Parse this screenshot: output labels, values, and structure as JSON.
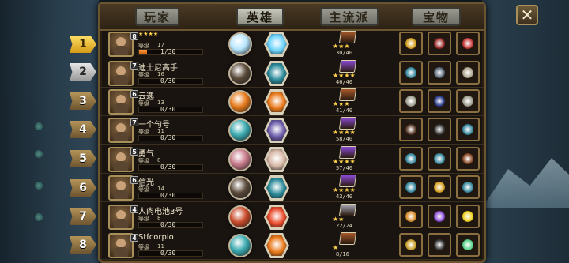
{
  "tabs": [
    {
      "label": "玩家",
      "active": false
    },
    {
      "label": "英雄",
      "active": true
    },
    {
      "label": "主流派",
      "active": false
    },
    {
      "label": "宝物",
      "active": false
    }
  ],
  "close_label": "✕",
  "rows": [
    {
      "rank": "1",
      "vip": "8",
      "name": "",
      "stars": "★★★★",
      "level_label": "等级",
      "level": "17",
      "xp": "1/30",
      "xp_fraction": 0.12,
      "book_stars": "★★★",
      "book_count": "30/40",
      "book_color": "#a85a2a",
      "hero_color": "#b8e6ff",
      "hex_color": "#6ad4ff",
      "treasures": [
        "#d4a020",
        "#9a2a2a",
        "#c83a3a"
      ]
    },
    {
      "rank": "2",
      "vip": "7",
      "name": "迪士尼高手",
      "stars": "",
      "level_label": "等级",
      "level": "16",
      "xp": "0/30",
      "xp_fraction": 0,
      "book_stars": "★★★★",
      "book_count": "46/40",
      "book_color": "#8a4ad4",
      "hero_color": "#5a4a3a",
      "hex_color": "#2a8a9a",
      "treasures": [
        "#3a8aa0",
        "#5a6a7a",
        "#b0a890"
      ]
    },
    {
      "rank": "3",
      "vip": "6",
      "name": "云逸",
      "stars": "",
      "level_label": "等级",
      "level": "13",
      "xp": "0/30",
      "xp_fraction": 0,
      "book_stars": "★★★",
      "book_count": "41/40",
      "book_color": "#a85a2a",
      "hero_color": "#e87a1a",
      "hex_color": "#e8781a",
      "treasures": [
        "#a0a090",
        "#2a3a8a",
        "#a0a090"
      ]
    },
    {
      "rank": "4",
      "vip": "7",
      "name": "一个句号",
      "stars": "",
      "level_label": "等级",
      "level": "11",
      "xp": "0/30",
      "xp_fraction": 0,
      "book_stars": "★★★★",
      "book_count": "58/40",
      "book_color": "#8a4ad4",
      "hero_color": "#3aaab0",
      "hex_color": "#6a5aa8",
      "treasures": [
        "#5a3a2a",
        "#3a3a3a",
        "#3a8aa0"
      ]
    },
    {
      "rank": "5",
      "vip": "5",
      "name": "勇气",
      "stars": "",
      "level_label": "等级",
      "level": "8",
      "xp": "0/30",
      "xp_fraction": 0,
      "book_stars": "★★★★",
      "book_count": "57/40",
      "book_color": "#8a4ad4",
      "hero_color": "#c87a8a",
      "hex_color": "#d8b8a8",
      "treasures": [
        "#3a8aa0",
        "#3a8aa0",
        "#8a4a2a"
      ]
    },
    {
      "rank": "6",
      "vip": "6",
      "name": "信光",
      "stars": "",
      "level_label": "等级",
      "level": "14",
      "xp": "0/30",
      "xp_fraction": 0,
      "book_stars": "★★★★",
      "book_count": "43/40",
      "book_color": "#8a4ad4",
      "hero_color": "#5a4a3a",
      "hex_color": "#2a8a9a",
      "treasures": [
        "#3a8aa0",
        "#d4a020",
        "#3a8aa0"
      ]
    },
    {
      "rank": "7",
      "vip": "4",
      "name": "人肉电池3号",
      "stars": "",
      "level_label": "等级",
      "level": "8",
      "xp": "0/30",
      "xp_fraction": 0,
      "book_stars": "★★",
      "book_count": "22/24",
      "book_color": "#a8a8b8",
      "hero_color": "#c84a2a",
      "hex_color": "#e84a2a",
      "treasures": [
        "#d48a2a",
        "#8a4ad4",
        "#f0d020"
      ]
    },
    {
      "rank": "8",
      "vip": "4",
      "name": "Stfcorpio",
      "stars": "",
      "level_label": "等级",
      "level": "11",
      "xp": "0/30",
      "xp_fraction": 0,
      "book_stars": "★",
      "book_count": "8/16",
      "book_color": "#a85a2a",
      "hero_color": "#3aaab0",
      "hex_color": "#e8781a",
      "treasures": [
        "#c8a02a",
        "#3a3a3a",
        "#5ad48a"
      ]
    }
  ]
}
